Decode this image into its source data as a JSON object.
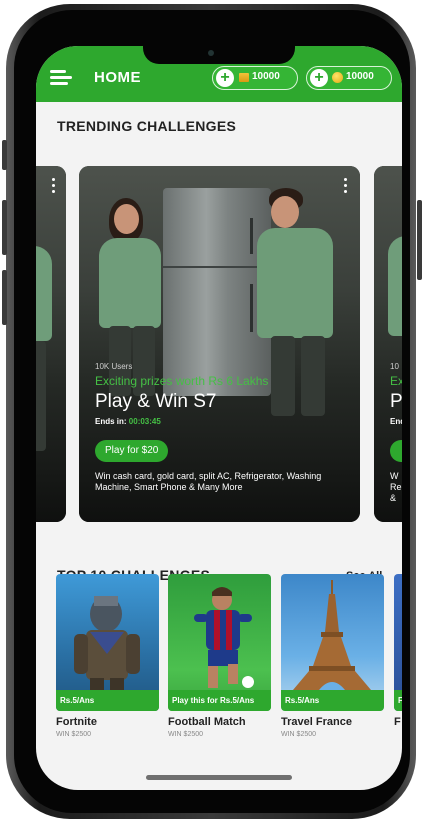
{
  "header": {
    "title": "HOME",
    "wallets": [
      {
        "icon": "gold-bar-icon",
        "amount": "10000"
      },
      {
        "icon": "coin-icon",
        "amount": "10000"
      }
    ]
  },
  "trending": {
    "title": "TRENDING CHALLENGES",
    "featured": {
      "users": "10K Users",
      "prize": "Exciting prizes worth Rs 6 Lakhs",
      "title": "Play & Win S7",
      "ends_label": "Ends in:",
      "ends_time": "00:03:45",
      "play_label": "Play for $20",
      "description": "Win cash card, gold card, split AC, Refrigerator, Washing Machine, Smart Phone & Many More"
    },
    "peek_right": {
      "users": "10",
      "prize": "Ex",
      "title": "P",
      "ends": "End",
      "desc_lines": [
        "W",
        "Re",
        "&"
      ]
    }
  },
  "top10": {
    "title": "TOP 10 CHALLENGES",
    "see_all": "See All",
    "items": [
      {
        "name": "Fortnite",
        "price": "Rs.5/Ans",
        "win": "WIN $2500"
      },
      {
        "name": "Football Match",
        "price": "Play this for Rs.5/Ans",
        "win": "WIN $2500"
      },
      {
        "name": "Travel France",
        "price": "Rs.5/Ans",
        "win": "WIN $2500"
      },
      {
        "name": "F",
        "price": "F",
        "win": ""
      }
    ]
  },
  "colors": {
    "accent": "#2ea82e",
    "prize_green": "#45c045"
  }
}
